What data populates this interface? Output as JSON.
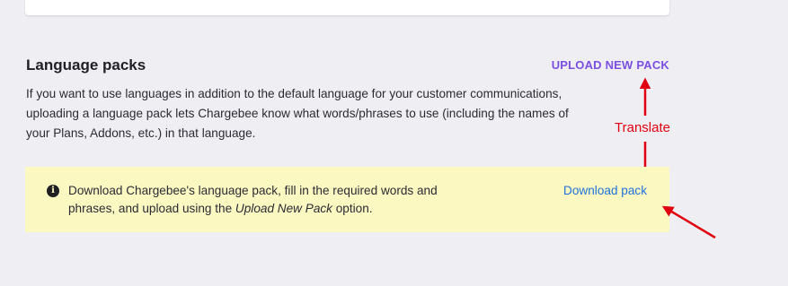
{
  "section": {
    "title": "Language packs",
    "upload_label": "UPLOAD NEW PACK",
    "description": "If you want to use languages in addition to the default language for your customer communications, uploading a language pack lets Chargebee know what words/phrases to use (including the names of your Plans, Addons, etc.) in that language."
  },
  "notice": {
    "icon": "info-icon",
    "text_before": "Download Chargebee's language pack, fill in the required words and phrases, and upload using the ",
    "text_emphasis": "Upload New Pack",
    "text_after": " option.",
    "download_label": "Download pack"
  },
  "annotation": {
    "label": "Translate",
    "color": "#e00010"
  },
  "colors": {
    "background": "#efeef3",
    "accent_purple": "#7b4fe0",
    "link_blue": "#1f72d9",
    "notice_background": "#fbf8c2"
  }
}
